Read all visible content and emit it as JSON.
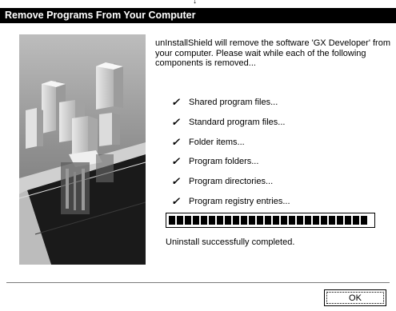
{
  "window": {
    "title": "Remove Programs From Your Computer"
  },
  "description": "unInstallShield will remove the software 'GX Developer' from your computer.  Please wait while each of the following components is removed...",
  "components": [
    {
      "label": "Shared program files..."
    },
    {
      "label": "Standard program files..."
    },
    {
      "label": "Folder items..."
    },
    {
      "label": "Program folders..."
    },
    {
      "label": "Program directories..."
    },
    {
      "label": "Program registry entries..."
    }
  ],
  "progress": {
    "percent": 100,
    "status_text": "Uninstall successfully completed."
  },
  "buttons": {
    "ok_label": "OK"
  },
  "icons": {
    "check": "checkmark-icon",
    "art": "installer-buildings-illustration"
  },
  "colors": {
    "titlebar": "#000000",
    "art_background": "#8a8a8a"
  }
}
